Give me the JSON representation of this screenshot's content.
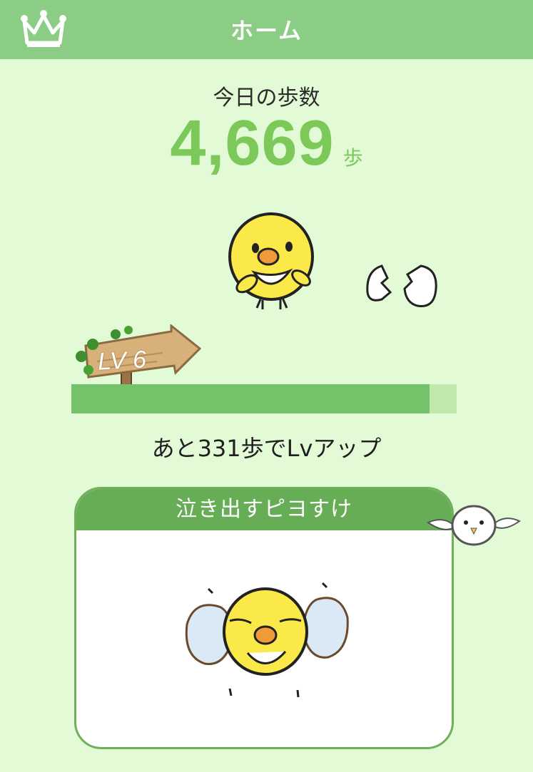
{
  "header": {
    "title": "ホーム",
    "crown_icon": "crown-icon"
  },
  "steps": {
    "label": "今日の歩数",
    "count": "4,669",
    "unit": "歩"
  },
  "level": {
    "label": "LV 6",
    "progress_fraction": 0.93,
    "levelup_text": "あと331歩でLvアップ"
  },
  "card": {
    "title": "泣き出すピヨすけ"
  },
  "colors": {
    "background": "#e2fbd6",
    "header": "#8ccd85",
    "accent_green": "#7cc95a",
    "progress_fill": "#74c36a",
    "progress_track": "#c2e8ad",
    "card_header": "#66ad56",
    "chick_yellow": "#fbe94a"
  }
}
